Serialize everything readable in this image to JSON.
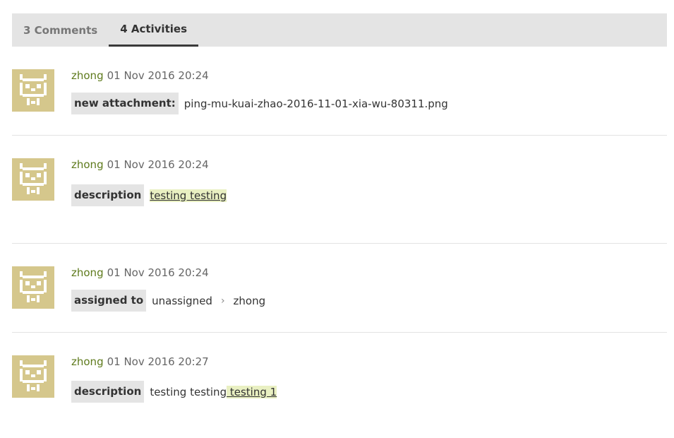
{
  "tabs": [
    {
      "label": "3 Comments",
      "active": false
    },
    {
      "label": "4 Activities",
      "active": true
    }
  ],
  "colors": {
    "author": "#5e7a1c",
    "avatar_bg": "#d5c78c",
    "tab_bar": "#e4e4e4",
    "highlight": "#e9f0c2"
  },
  "activities": [
    {
      "author": "zhong",
      "date": "01 Nov 2016 20:24",
      "label": "new attachment:",
      "value": "ping-mu-kuai-zhao-2016-11-01-xia-wu-80311.png"
    },
    {
      "author": "zhong",
      "date": "01 Nov 2016 20:24",
      "label": "description",
      "added": "testing testing"
    },
    {
      "author": "zhong",
      "date": "01 Nov 2016 20:24",
      "label": "assigned to",
      "from": "unassigned",
      "to": "zhong"
    },
    {
      "author": "zhong",
      "date": "01 Nov 2016 20:27",
      "label": "description",
      "unchanged": "testing testing",
      "added": " testing 1"
    }
  ]
}
